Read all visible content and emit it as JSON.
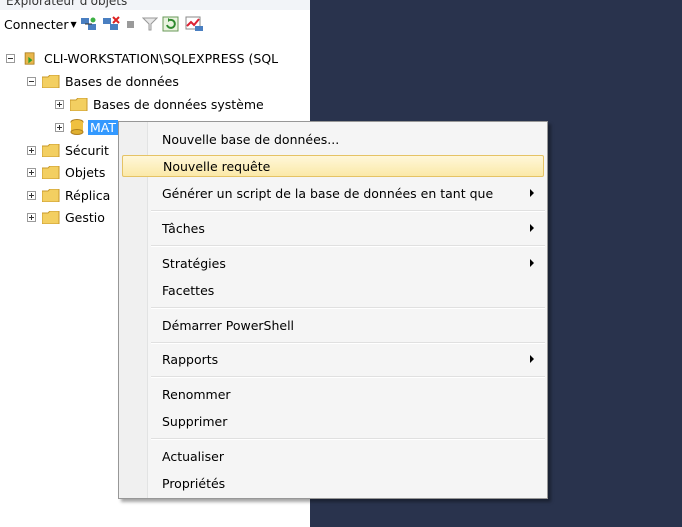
{
  "window": {
    "title": "Explorateur d'objets"
  },
  "toolbar": {
    "connect_label": "Connecter",
    "icons": [
      "connect-object-explorer-icon",
      "disconnect-icon",
      "stop-icon",
      "filter-icon",
      "refresh-icon",
      "activity-monitor-icon"
    ]
  },
  "tree": {
    "server": "CLI-WORKSTATION\\SQLEXPRESS (SQL",
    "databases": "Bases de données",
    "system_databases": "Bases de données système",
    "selected_db": "MAT",
    "security": "Sécurit",
    "server_objects": "Objets",
    "replication": "Réplica",
    "management": "Gestio"
  },
  "context_menu": {
    "new_database": "Nouvelle base de données...",
    "new_query": "Nouvelle requête",
    "script_database": "Générer un script de la base de données en tant que",
    "tasks": "Tâches",
    "policies": "Stratégies",
    "facets": "Facettes",
    "start_powershell": "Démarrer PowerShell",
    "reports": "Rapports",
    "rename": "Renommer",
    "delete": "Supprimer",
    "refresh": "Actualiser",
    "properties": "Propriétés"
  },
  "colors": {
    "background_dark": "#29334d",
    "selection": "#3399ff",
    "menu_highlight": "#fbe9a8"
  }
}
